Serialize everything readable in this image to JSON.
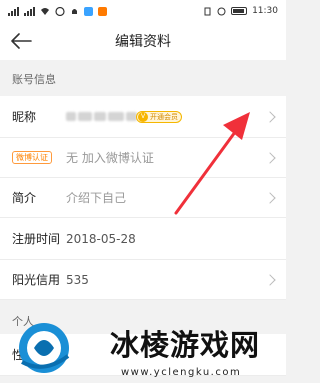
{
  "status_bar": {
    "time": "11:30",
    "icons": [
      "signal-icon",
      "signal-icon",
      "wifi-icon",
      "message-icon",
      "bell-icon",
      "app-icon",
      "shopping-icon"
    ]
  },
  "nav": {
    "title": "编辑资料",
    "back_icon": "arrow-left-icon"
  },
  "sections": {
    "account": "账号信息",
    "personal": "个人"
  },
  "rows": {
    "nickname": {
      "label": "昵称",
      "vip_badge": "开通会员"
    },
    "weibo": {
      "badge": "微博认证",
      "value": "无 加入微博认证"
    },
    "intro": {
      "label": "简介",
      "value": "介绍下自己"
    },
    "register": {
      "label": "注册时间",
      "value": "2018-05-28"
    },
    "credit": {
      "label": "阳光信用",
      "value": "535"
    },
    "gender": {
      "label": "性别"
    }
  },
  "watermark": {
    "text": "冰棱游戏网",
    "url": "www.yclengku.com"
  },
  "colors": {
    "annotation_arrow": "#f0303a",
    "vip_gold": "#f5b700",
    "weibo_orange": "#ff8200"
  }
}
